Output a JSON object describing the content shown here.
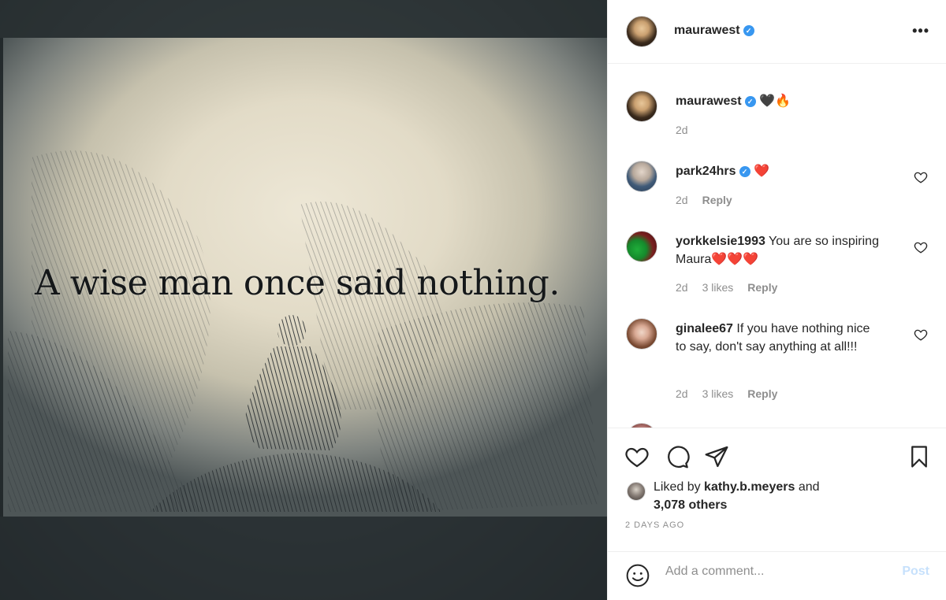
{
  "post": {
    "image_quote": "A wise man once said nothing."
  },
  "header": {
    "username": "maurawest",
    "more_label": "•••"
  },
  "comments": [
    {
      "username": "maurawest",
      "text": "🖤🔥",
      "age": "2d",
      "likes": "",
      "reply": ""
    },
    {
      "username": "park24hrs",
      "text": "❤️",
      "age": "2d",
      "likes": "",
      "reply": "Reply"
    },
    {
      "username": "yorkkelsie1993",
      "text": "You are so inspiring Maura❤️❤️❤️",
      "age": "2d",
      "likes": "3 likes",
      "reply": "Reply"
    },
    {
      "username": "ginalee67",
      "text": "If you have nothing nice to say, don't say anything at all!!!",
      "age": "2d",
      "likes": "3 likes",
      "reply": "Reply"
    }
  ],
  "engagement": {
    "liked_by_prefix": "Liked by",
    "liked_by_user": "kathy.b.meyers",
    "and_label": "and",
    "others_count": "3,078 others",
    "timestamp": "2 DAYS AGO"
  },
  "add_comment": {
    "placeholder": "Add a comment...",
    "post_label": "Post"
  },
  "icons": [
    "more-options-icon",
    "verified-badge-icon",
    "heart-icon",
    "comment-icon",
    "share-icon",
    "bookmark-icon",
    "emoji-icon"
  ],
  "colors": {
    "verified": "#3897f0",
    "muted": "#8e8e8e",
    "post_disabled": "#c7e1fc"
  }
}
